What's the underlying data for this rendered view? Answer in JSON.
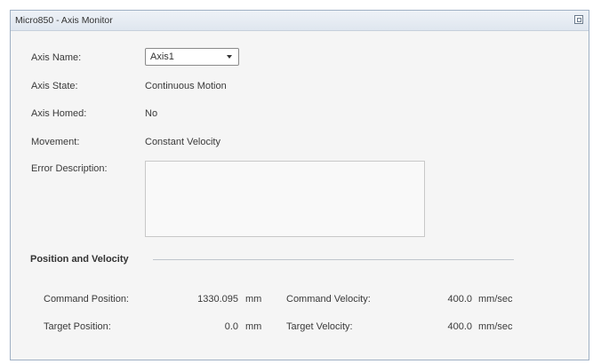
{
  "window": {
    "title": "Micro850 - Axis Monitor"
  },
  "axis": {
    "name_label": "Axis Name:",
    "name_value": "Axis1",
    "state_label": "Axis State:",
    "state_value": "Continuous Motion",
    "homed_label": "Axis Homed:",
    "homed_value": "No",
    "movement_label": "Movement:",
    "movement_value": "Constant Velocity",
    "error_label": "Error Description:",
    "error_value": ""
  },
  "position_velocity": {
    "section_title": "Position and Velocity",
    "command_position_label": "Command Position:",
    "command_position_value": "1330.095",
    "command_position_unit": "mm",
    "target_position_label": "Target Position:",
    "target_position_value": "0.0",
    "target_position_unit": "mm",
    "command_velocity_label": "Command Velocity:",
    "command_velocity_value": "400.0",
    "command_velocity_unit": "mm/sec",
    "target_velocity_label": "Target Velocity:",
    "target_velocity_value": "400.0",
    "target_velocity_unit": "mm/sec"
  },
  "icons": {
    "dropdown": "chevron-down-icon",
    "restore": "restore-window-icon"
  }
}
